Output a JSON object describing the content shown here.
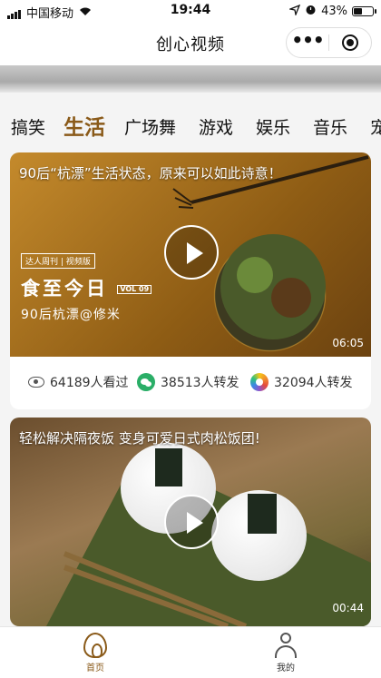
{
  "status_bar": {
    "carrier": "中国移动",
    "time": "19:44",
    "battery": "43%",
    "battery_level": 0.43
  },
  "nav": {
    "title": "创心视频"
  },
  "tabs": [
    {
      "label": "搞笑",
      "active": false
    },
    {
      "label": "生活",
      "active": true
    },
    {
      "label": "广场舞",
      "active": false
    },
    {
      "label": "游戏",
      "active": false
    },
    {
      "label": "娱乐",
      "active": false
    },
    {
      "label": "音乐",
      "active": false
    },
    {
      "label": "宠",
      "active": false
    }
  ],
  "videos": [
    {
      "title": "90后“杭漂”生活状态，原来可以如此诗意！",
      "duration": "06:05",
      "thumbnail_text": {
        "tag": "达人周刊 | 视频版",
        "headline": "食至今日",
        "vol": "VOL 09",
        "subtitle": "90后杭漂@修米"
      },
      "stats": {
        "views": "64189人看过",
        "wechat_shares": "38513人转发",
        "moments_shares": "32094人转发"
      }
    },
    {
      "title": "轻松解决隔夜饭 变身可爱日式肉松饭团!",
      "duration": "00:44"
    }
  ],
  "tabbar": {
    "home": "首页",
    "me": "我的"
  },
  "colors": {
    "accent": "#8a5a19"
  }
}
